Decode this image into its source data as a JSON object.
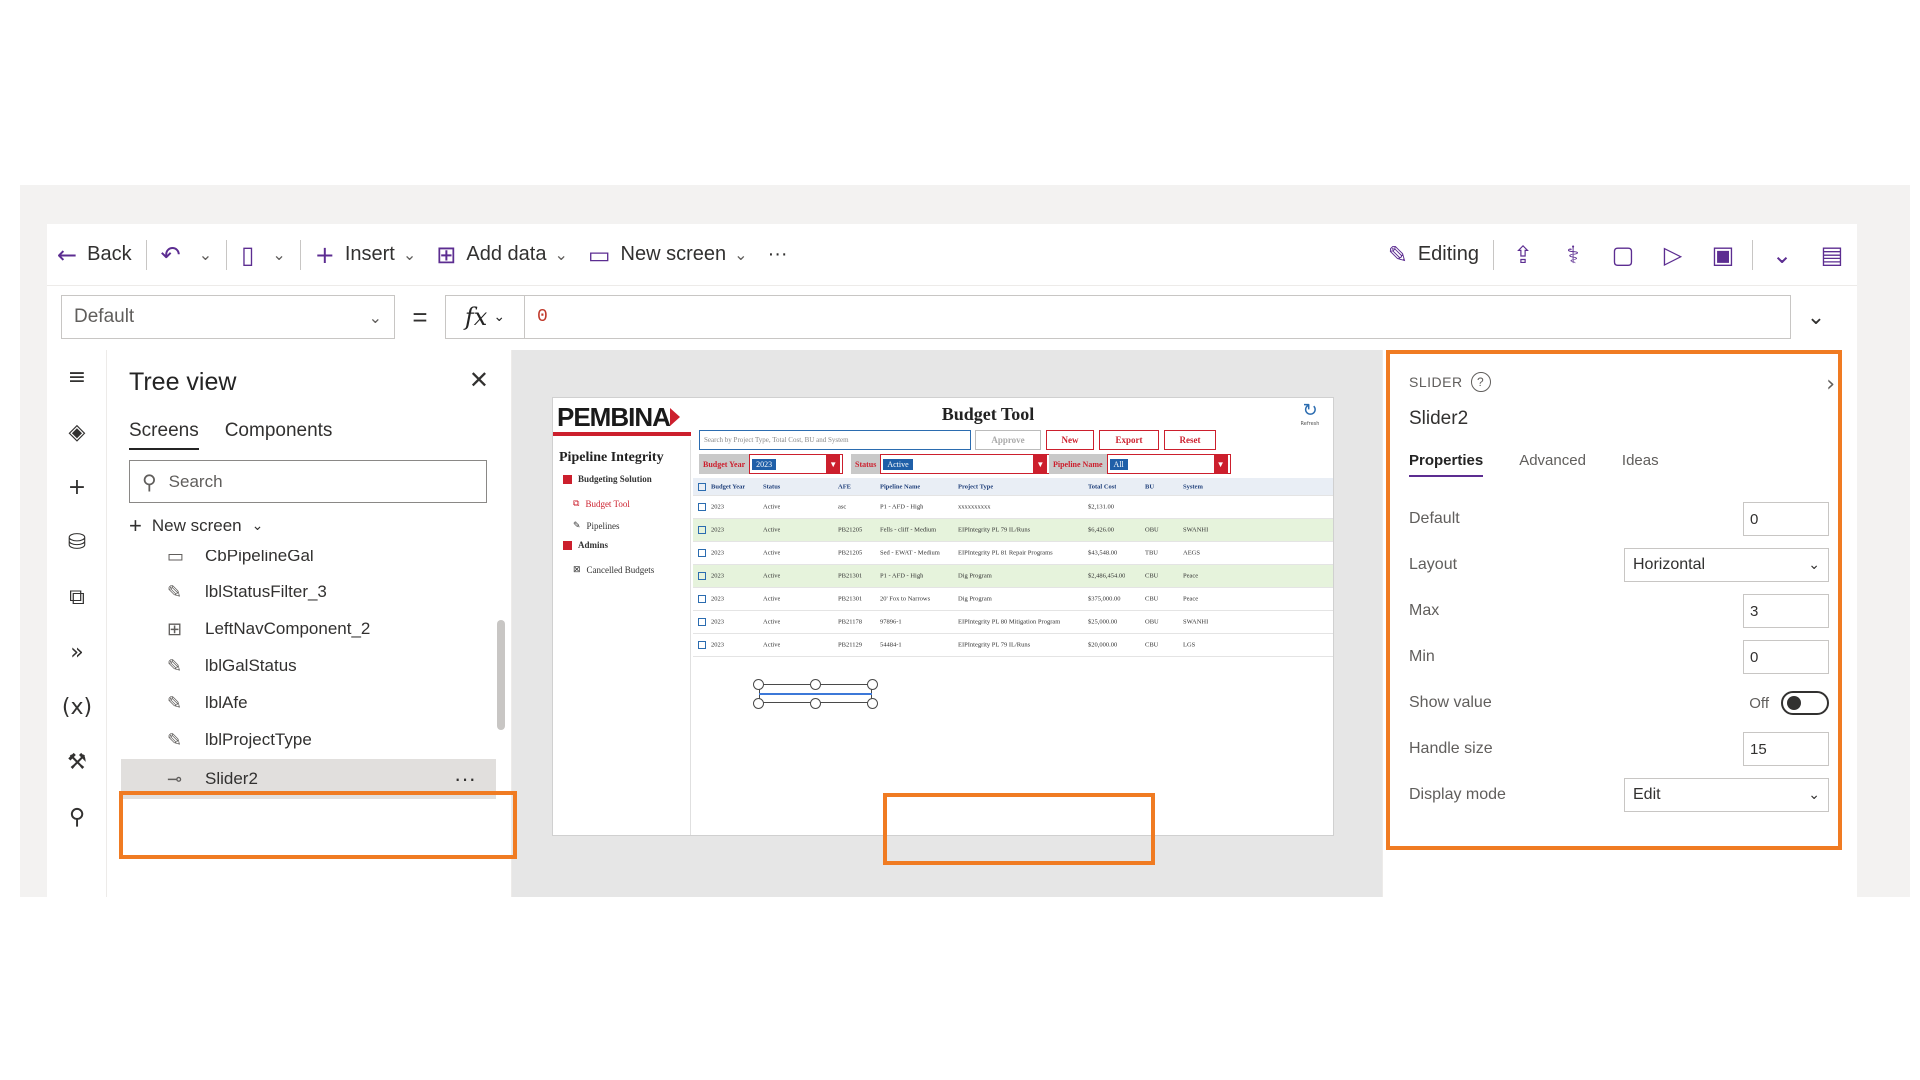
{
  "command_bar": {
    "back": "Back",
    "insert": "Insert",
    "add_data": "Add data",
    "new_screen": "New screen",
    "more": "···",
    "editing": "Editing"
  },
  "formula_bar": {
    "property": "Default",
    "equals": "=",
    "fx": "fx",
    "formula": "0"
  },
  "tree_view": {
    "title": "Tree view",
    "tabs": [
      "Screens",
      "Components"
    ],
    "search_placeholder": "Search",
    "new_screen": "New screen",
    "items": [
      {
        "label": "CbPipelineGal",
        "icon": "gallery-icon"
      },
      {
        "label": "lblStatusFilter_3",
        "icon": "label-edit-icon"
      },
      {
        "label": "LeftNavComponent_2",
        "icon": "component-icon"
      },
      {
        "label": "lblGalStatus",
        "icon": "label-edit-icon"
      },
      {
        "label": "lblAfe",
        "icon": "label-edit-icon"
      },
      {
        "label": "lblProjectType",
        "icon": "label-edit-icon"
      },
      {
        "label": "Slider2",
        "icon": "slider-icon"
      }
    ],
    "selected_more": "···"
  },
  "app_preview": {
    "logo": "PEMBINA",
    "section": "Pipeline Integrity",
    "nav": [
      "Budgeting Solution",
      "Budget Tool",
      "Pipelines",
      "Admins",
      "Cancelled Budgets"
    ],
    "title": "Budget Tool",
    "refresh": "Refresh",
    "search_placeholder": "Search by Project Type, Total Cost, BU and System",
    "buttons": {
      "approve": "Approve",
      "new": "New",
      "export": "Export",
      "reset": "Reset"
    },
    "filters": [
      {
        "label": "Budget Year",
        "value": "2023"
      },
      {
        "label": "Status",
        "value": "Active"
      },
      {
        "label": "Pipeline Name",
        "value": "All"
      }
    ],
    "columns": [
      "Budget Year",
      "Status",
      "AFE",
      "Pipeline Name",
      "Project Type",
      "Total Cost",
      "BU",
      "System"
    ],
    "rows": [
      [
        "2023",
        "Active",
        "asc",
        "P1 - AFD - High",
        "xxxxxxxxxx",
        "$2,131.00",
        "",
        ""
      ],
      [
        "2023",
        "Active",
        "PB21205",
        "Fells - cliff - Medium",
        "EIPIntegrity PL 79 IL/Runs",
        "$6,426.00",
        "OBU",
        "SWANHI"
      ],
      [
        "2023",
        "Active",
        "PB21205",
        "Sed - EWAT - Medium",
        "EIPIntegrity PL 81 Repair Programs",
        "$43,548.00",
        "TBU",
        "AEGS"
      ],
      [
        "2023",
        "Active",
        "PB21301",
        "P1 - AFD - High",
        "Dig Program",
        "$2,486,454.00",
        "CBU",
        "Peace"
      ],
      [
        "2023",
        "Active",
        "PB21301",
        "20' Fox to Narrows",
        "Dig Program",
        "$375,000.00",
        "CBU",
        "Peace"
      ],
      [
        "2023",
        "Active",
        "PB21178",
        "97896-1",
        "EIPIntegrity PL 80 Mitigation Program",
        "$25,000.00",
        "OBU",
        "SWANHI"
      ],
      [
        "2023",
        "Active",
        "PB21129",
        "54484-1",
        "EIPIntegrity PL 79 IL/Runs",
        "$20,000.00",
        "CBU",
        "LGS"
      ]
    ]
  },
  "properties": {
    "kind": "SLIDER",
    "name": "Slider2",
    "tabs": [
      "Properties",
      "Advanced",
      "Ideas"
    ],
    "default_label": "Default",
    "default_value": "0",
    "layout_label": "Layout",
    "layout_value": "Horizontal",
    "max_label": "Max",
    "max_value": "3",
    "min_label": "Min",
    "min_value": "0",
    "show_value_label": "Show value",
    "show_value_state": "Off",
    "handle_size_label": "Handle size",
    "handle_size_value": "15",
    "display_mode_label": "Display mode",
    "display_mode_value": "Edit"
  },
  "colors": {
    "accent": "#5c2d91",
    "highlight": "#f07b22",
    "brand_red": "#cc1f2d"
  }
}
